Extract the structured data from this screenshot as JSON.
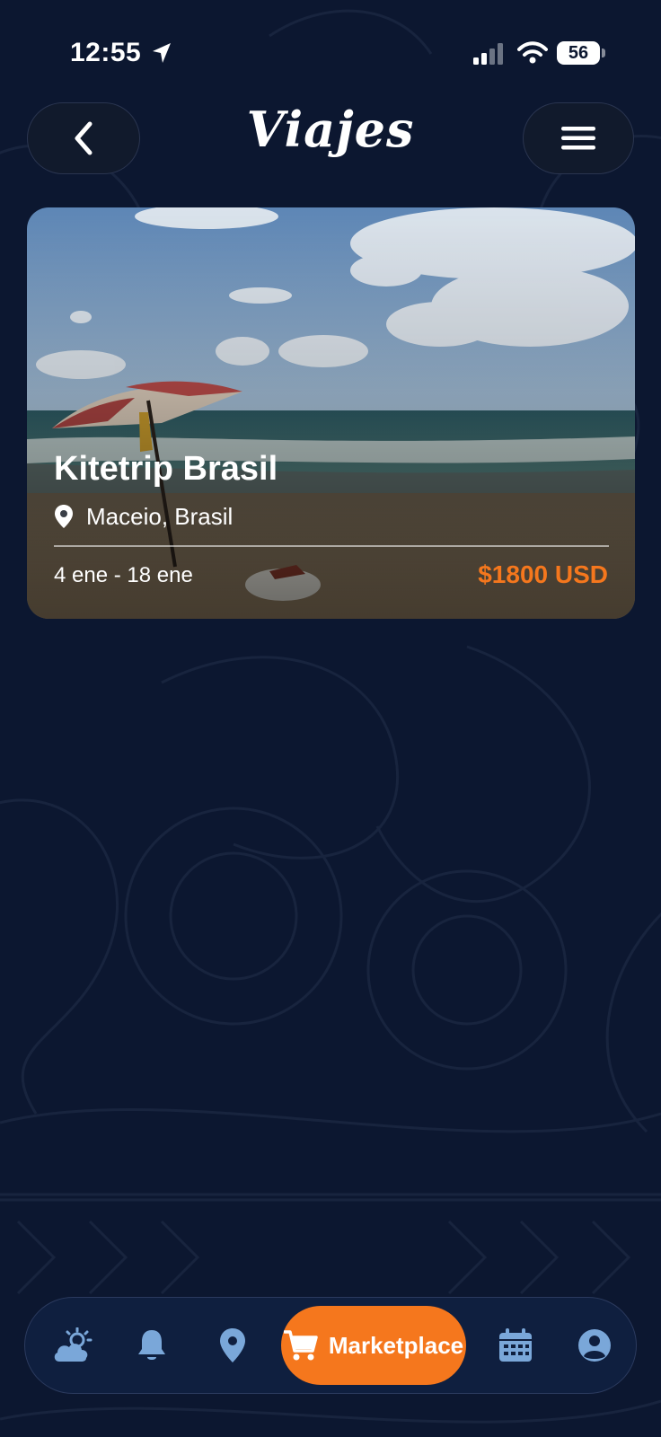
{
  "status_bar": {
    "time": "12:55",
    "battery": "56"
  },
  "header": {
    "title": "Viajes"
  },
  "trip": {
    "title": "Kitetrip Brasil",
    "location": "Maceio, Brasil",
    "dates": "4 ene - 18 ene",
    "price": "$1800 USD"
  },
  "bottom_nav": {
    "items": [
      {
        "icon": "weather-icon"
      },
      {
        "icon": "bell-icon"
      },
      {
        "icon": "location-pin-icon"
      },
      {
        "icon": "cart-icon",
        "label": "Marketplace",
        "active": true
      },
      {
        "icon": "calendar-icon"
      },
      {
        "icon": "user-icon"
      }
    ]
  },
  "colors": {
    "background": "#0c1730",
    "accent": "#f5771d",
    "nav_icon": "#7aa7d9"
  }
}
